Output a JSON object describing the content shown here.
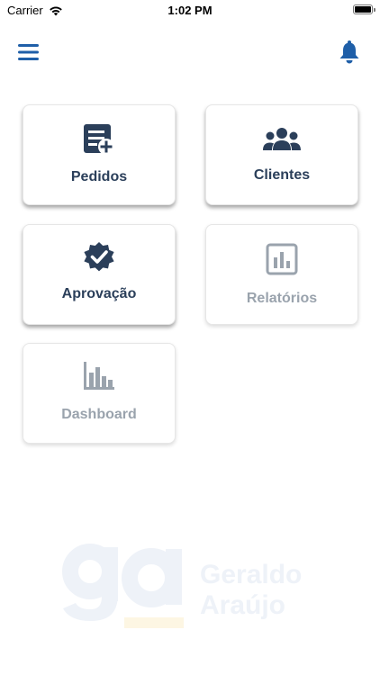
{
  "status_bar": {
    "carrier": "Carrier",
    "time": "1:02 PM"
  },
  "header": {
    "menu_icon": "hamburger-menu-icon",
    "notification_icon": "bell-icon"
  },
  "tiles": [
    {
      "label": "Pedidos",
      "icon": "add-document-icon",
      "enabled": true
    },
    {
      "label": "Clientes",
      "icon": "users-group-icon",
      "enabled": true
    },
    {
      "label": "Aprovação",
      "icon": "verified-badge-icon",
      "enabled": true
    },
    {
      "label": "Relatórios",
      "icon": "report-chart-icon",
      "enabled": false
    },
    {
      "label": "Dashboard",
      "icon": "bar-chart-icon",
      "enabled": false
    }
  ],
  "watermark": {
    "logo_text": "Geraldo Araújo",
    "monogram": "ga"
  },
  "colors": {
    "primary": "#2b3f5a",
    "accent_blue": "#1f5fa8",
    "disabled": "#9aa3ad"
  }
}
